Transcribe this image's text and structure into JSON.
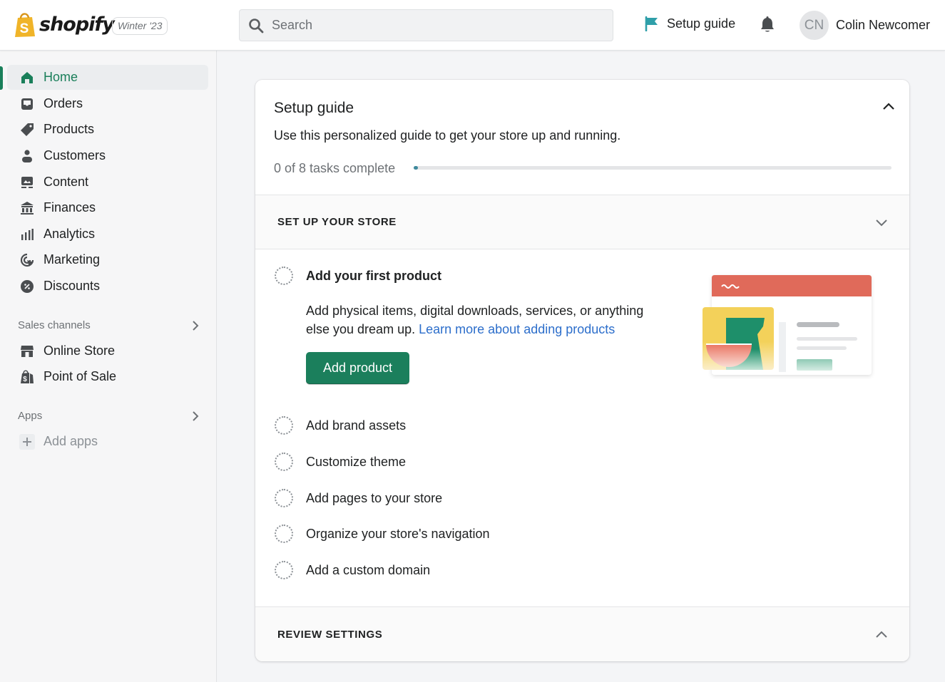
{
  "header": {
    "brand": "shopify",
    "edition_badge": "Winter '23",
    "search": {
      "placeholder": "Search",
      "value": ""
    },
    "setup_guide_label": "Setup guide",
    "user": {
      "initials": "CN",
      "name": "Colin Newcomer"
    }
  },
  "sidebar": {
    "items": [
      {
        "label": "Home",
        "icon": "home-icon",
        "active": true
      },
      {
        "label": "Orders",
        "icon": "orders-inbox-icon"
      },
      {
        "label": "Products",
        "icon": "tag-icon"
      },
      {
        "label": "Customers",
        "icon": "person-icon"
      },
      {
        "label": "Content",
        "icon": "content-image-icon"
      },
      {
        "label": "Finances",
        "icon": "bank-icon"
      },
      {
        "label": "Analytics",
        "icon": "bar-chart-icon"
      },
      {
        "label": "Marketing",
        "icon": "target-cursor-icon"
      },
      {
        "label": "Discounts",
        "icon": "discount-badge-icon"
      }
    ],
    "sales_channels": {
      "title": "Sales channels",
      "items": [
        {
          "label": "Online Store",
          "icon": "storefront-icon"
        },
        {
          "label": "Point of Sale",
          "icon": "shopify-bag-icon"
        }
      ]
    },
    "apps": {
      "title": "Apps",
      "add_label": "Add apps"
    }
  },
  "setup_card": {
    "title": "Setup guide",
    "description": "Use this personalized guide to get your store up and running.",
    "progress": {
      "completed": 0,
      "total": 8,
      "label": "0 of 8 tasks complete"
    },
    "sections": [
      {
        "title": "SET UP YOUR STORE",
        "expanded": true,
        "tasks": [
          {
            "label": "Add your first product",
            "expanded": true,
            "body": "Add physical items, digital downloads, services, or anything else you dream up.",
            "link": "Learn more about adding products",
            "button": "Add product"
          },
          {
            "label": "Add brand assets"
          },
          {
            "label": "Customize theme"
          },
          {
            "label": "Add pages to your store"
          },
          {
            "label": "Organize your store's navigation"
          },
          {
            "label": "Add a custom domain"
          }
        ]
      },
      {
        "title": "REVIEW SETTINGS",
        "expanded": false
      }
    ]
  },
  "colors": {
    "accent_green": "#1b7f5c",
    "link_blue": "#2c6ecb",
    "progress_teal": "#3f8a9d",
    "brand_yellow": "#f0b429"
  }
}
